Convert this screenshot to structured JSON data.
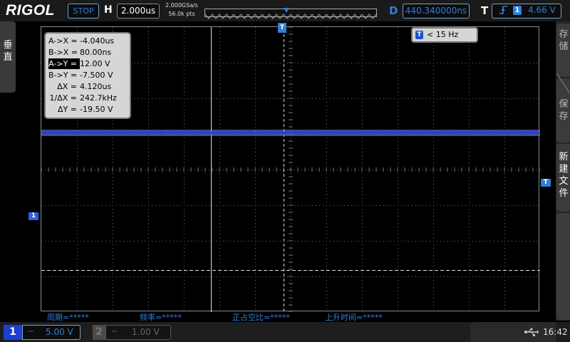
{
  "brand": "RIGOL",
  "top": {
    "run_state": "STOP",
    "horizontal_key": "H",
    "timebase": "2.000us",
    "sample_rate": "2.000GSa/s",
    "memory_depth": "56.0k pts",
    "delay_key": "D",
    "delay": "440.340000ns",
    "trigger_key": "T",
    "trigger_edge_icon": "rising-edge-icon",
    "trigger_source": "1",
    "trigger_level": "4.66 V"
  },
  "left_menu": {
    "label": "垂直"
  },
  "right_menu": {
    "items": [
      {
        "label": "存储"
      },
      {
        "label": "保存"
      },
      {
        "label": "新建文件"
      }
    ]
  },
  "cursors": {
    "rows": [
      {
        "key": "A->X =",
        "value": "-4.040us",
        "selected": false
      },
      {
        "key": "B->X =",
        "value": "80.00ns",
        "selected": false
      },
      {
        "key": "A->Y =",
        "value": "12.00 V",
        "selected": true
      },
      {
        "key": "B->Y =",
        "value": "-7.500 V",
        "selected": false
      },
      {
        "key": "ΔX =",
        "value": "4.120us",
        "selected": false
      },
      {
        "key": "1/ΔX =",
        "value": "242.7kHz",
        "selected": false
      },
      {
        "key": "ΔY =",
        "value": "-19.50 V",
        "selected": false
      }
    ]
  },
  "frequency": {
    "icon_label": "T",
    "value": "< 15 Hz"
  },
  "markers": {
    "ch1": "1",
    "trigger": "T",
    "tpos": "T"
  },
  "measurements": [
    {
      "label": "周期=*****"
    },
    {
      "label": "频率=*****"
    },
    {
      "label": "正占空比=*****"
    },
    {
      "label": "上升时间=*****"
    }
  ],
  "channels": [
    {
      "num": "1",
      "coupling_icon": "dc-coupling-icon",
      "scale": "5.00 V",
      "active": true
    },
    {
      "num": "2",
      "coupling_icon": "dc-coupling-icon",
      "scale": "1.00 V",
      "active": false
    }
  ],
  "status": {
    "usb_icon": "usb-icon",
    "time": "16:42"
  },
  "colors": {
    "accent": "#2f7fd6",
    "trace": "#2a3fd8",
    "grid": "#6f6f6f"
  }
}
